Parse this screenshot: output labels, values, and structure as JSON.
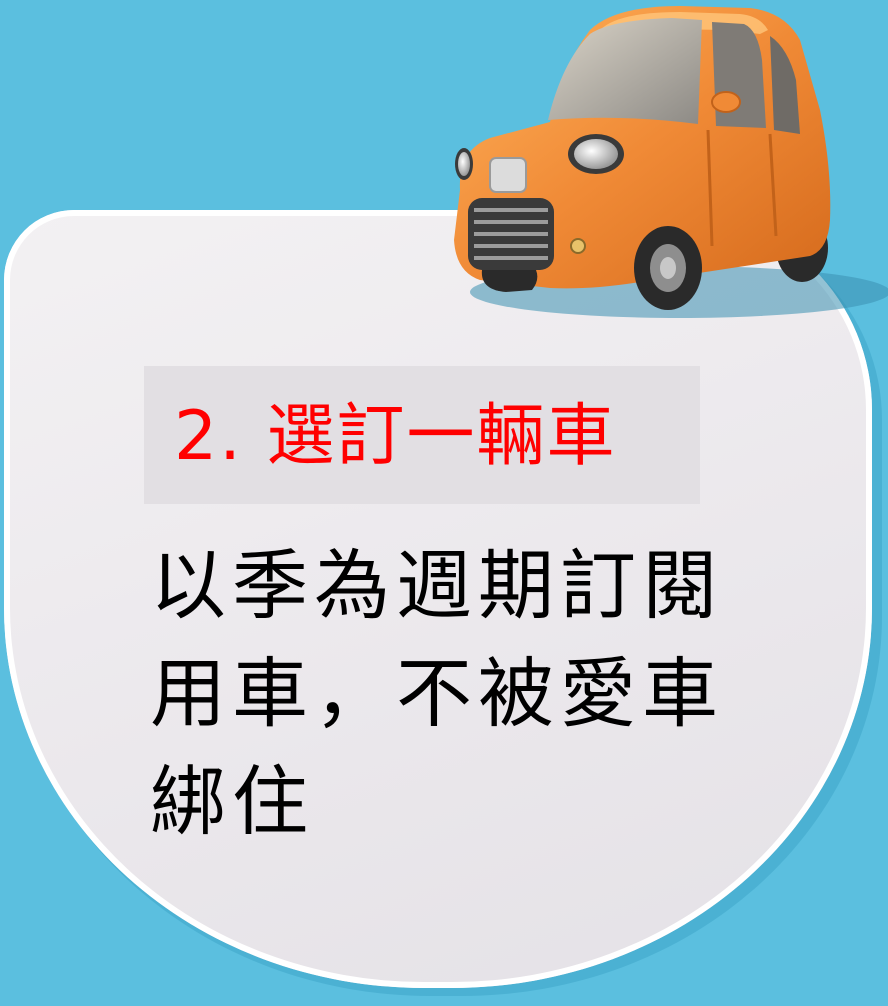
{
  "heading": "2. 選訂一輛車",
  "body": "以季為週期訂閱用車，不被愛車綁住",
  "illustration": {
    "icon": "car-icon",
    "body_color": "#f08a36"
  },
  "colors": {
    "background": "#5bbfdf",
    "card": "#efecef",
    "heading": "#ff0000",
    "text": "#000000"
  }
}
